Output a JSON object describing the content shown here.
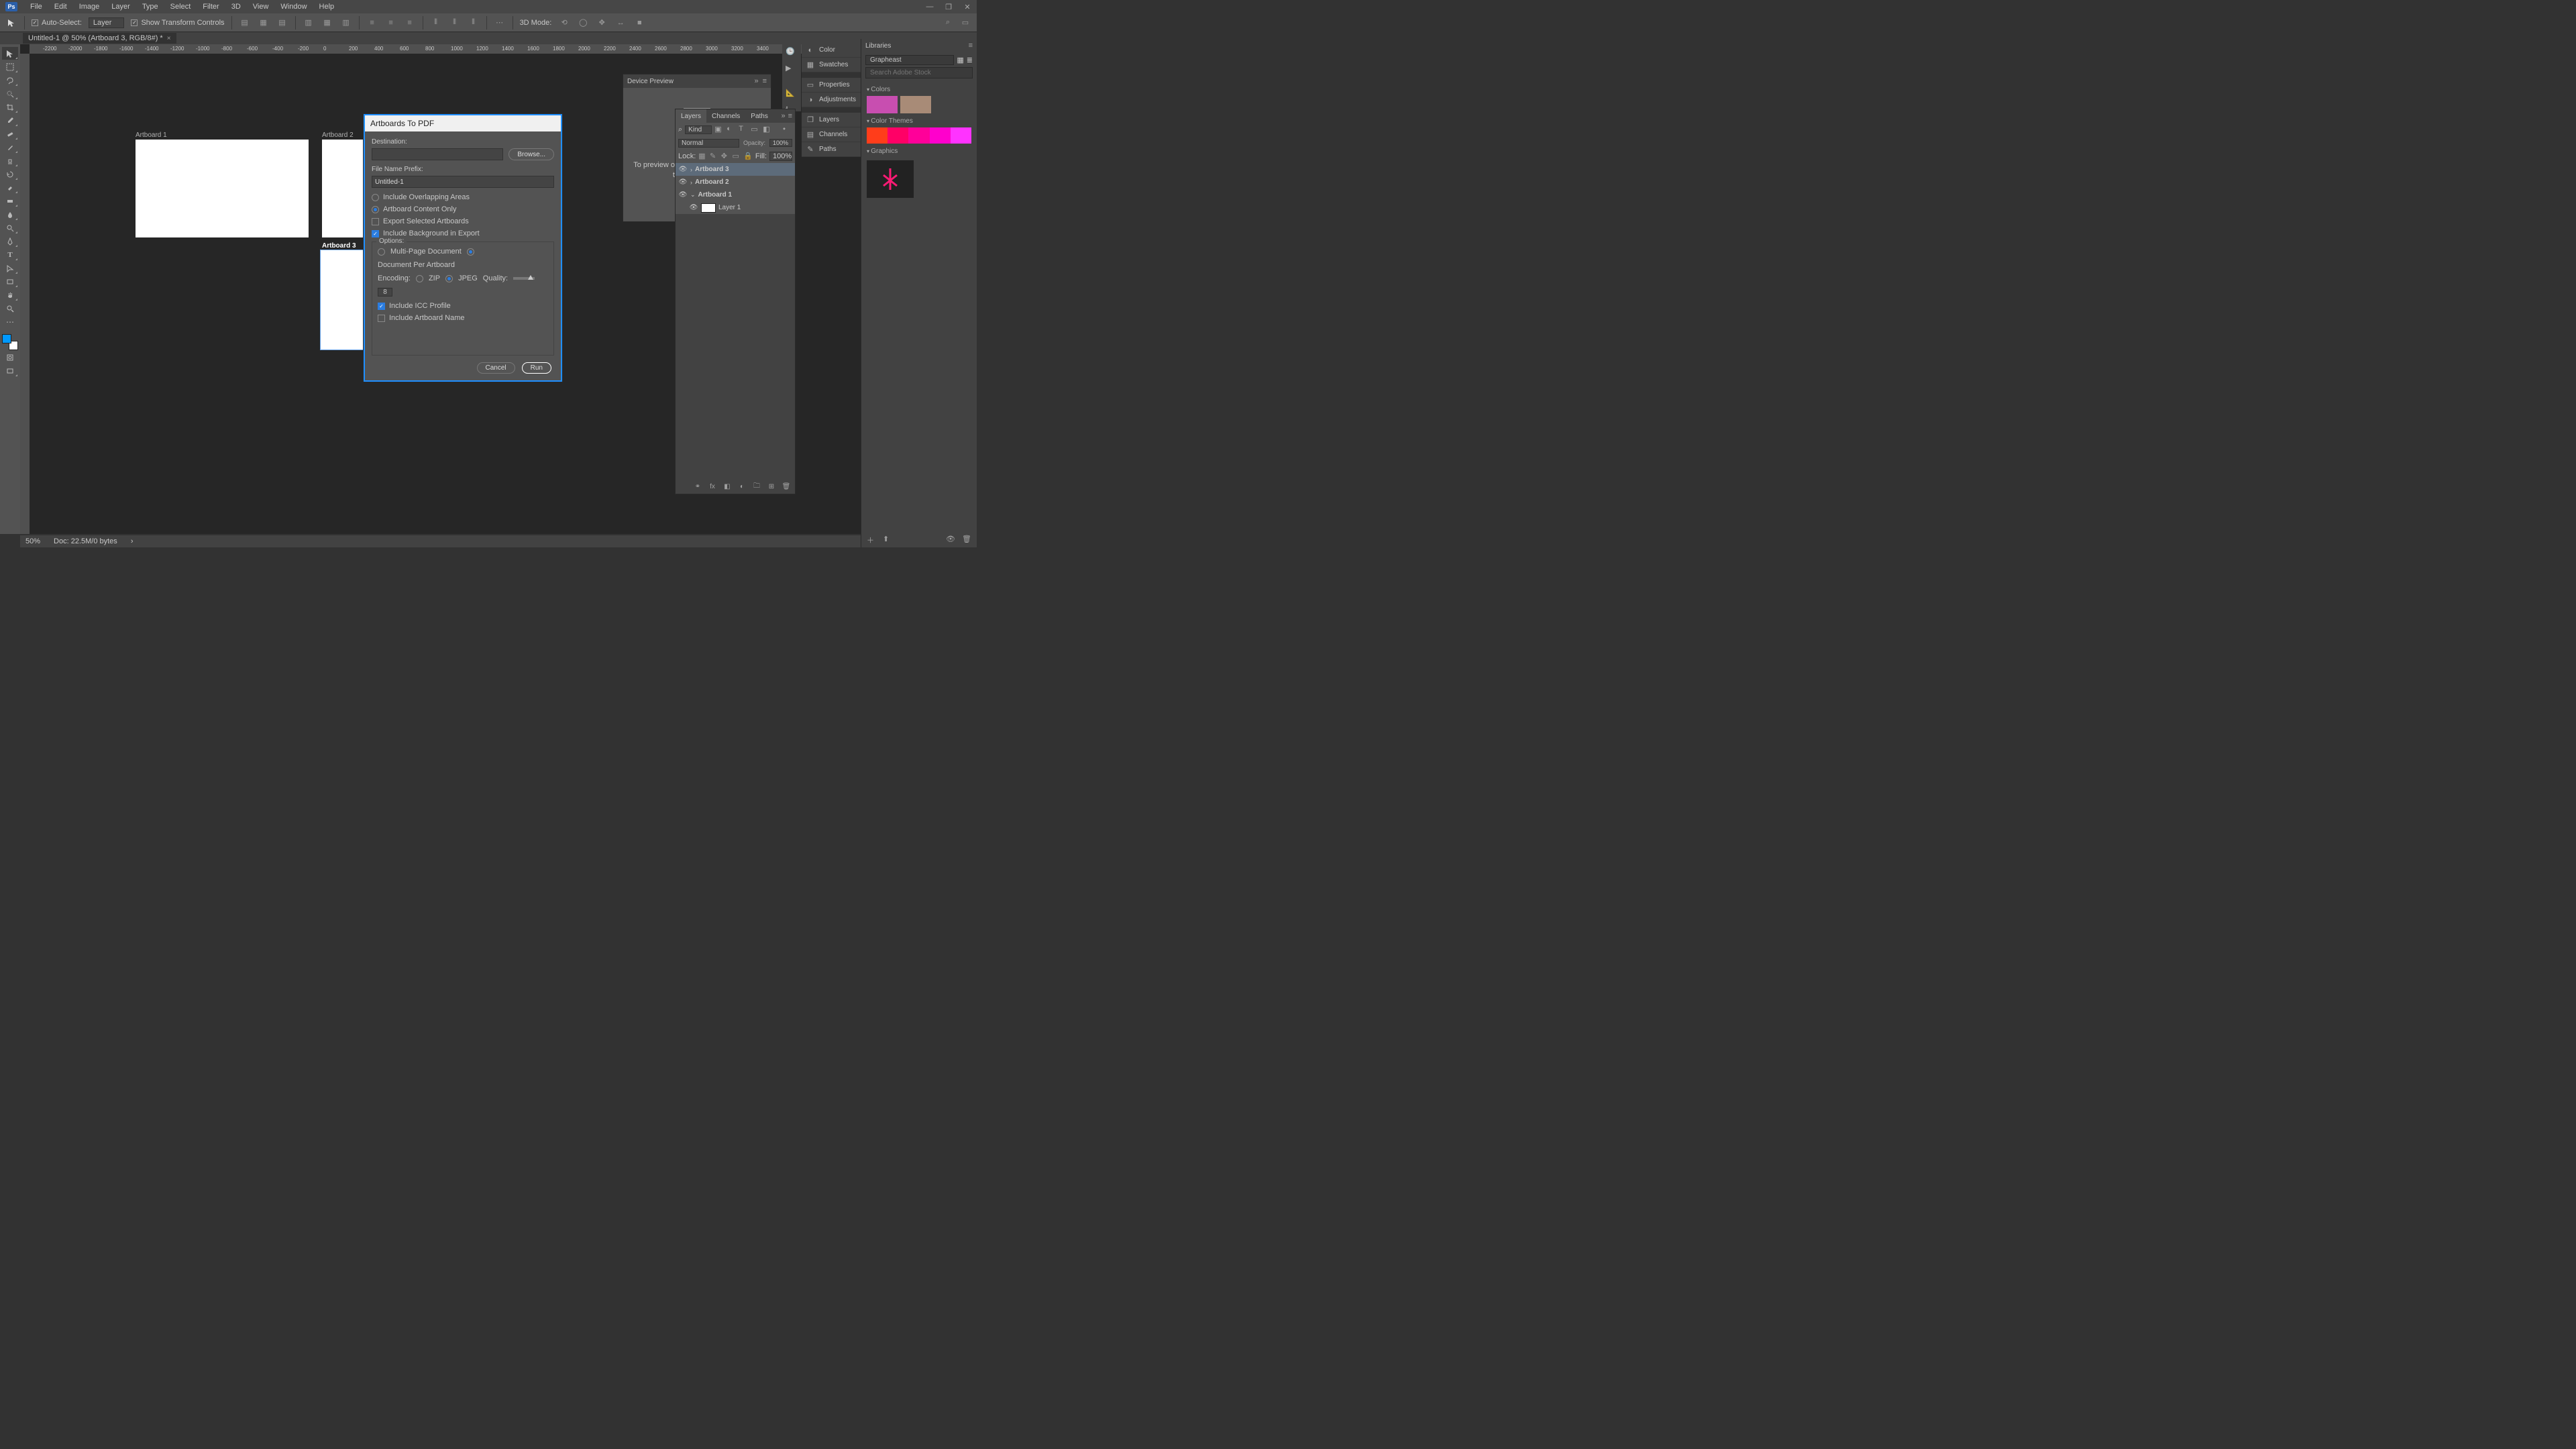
{
  "os": {
    "min": "—",
    "restore": "❐",
    "close": "✕"
  },
  "app": "Ps",
  "menu": [
    "File",
    "Edit",
    "Image",
    "Layer",
    "Type",
    "Select",
    "Filter",
    "3D",
    "View",
    "Window",
    "Help"
  ],
  "options": {
    "auto_select": "Auto-Select:",
    "target": "Layer",
    "show_transform": "Show Transform Controls",
    "mode3d": "3D Mode:"
  },
  "doctab": "Untitled-1 @ 50% (Artboard 3, RGB/8#) *",
  "ruler_marks": [
    -2200,
    -2000,
    -1800,
    -1600,
    -1400,
    -1200,
    -1000,
    -800,
    -600,
    -400,
    -200,
    0,
    200,
    400,
    600,
    800,
    1000,
    1200,
    1400,
    1600,
    1800,
    2000,
    2200,
    2400,
    2600,
    2800,
    3000,
    3200,
    3400
  ],
  "artboards": {
    "a1": "Artboard 1",
    "a2": "Artboard 2",
    "a3": "Artboard 3"
  },
  "device_preview": {
    "title": "Device Preview",
    "text": "To preview on physical devices, launch the mobile app"
  },
  "right_panels": [
    "Color",
    "Swatches",
    "Properties",
    "Adjustments",
    "Layers",
    "Channels",
    "Paths"
  ],
  "layers_panel": {
    "tabs": [
      "Layers",
      "Channels",
      "Paths"
    ],
    "kind": "Kind",
    "blend": "Normal",
    "opacity_label": "Opacity:",
    "opacity_value": "100%",
    "lock_label": "Lock:",
    "fill_label": "Fill:",
    "fill_value": "100%",
    "items": [
      {
        "name": "Artboard 3",
        "bold": true,
        "selected": true
      },
      {
        "name": "Artboard 2",
        "bold": true,
        "selected": false
      },
      {
        "name": "Artboard 1",
        "bold": true,
        "selected": false
      },
      {
        "name": "Layer 1",
        "bold": false,
        "selected": false,
        "thumb": true
      }
    ]
  },
  "libraries": {
    "title": "Libraries",
    "selected": "Grapheast",
    "search_placeholder": "Search Adobe Stock",
    "sections": {
      "colors": "Colors",
      "themes": "Color Themes",
      "graphics": "Graphics"
    },
    "color_swatches": [
      "#c84eb0",
      "#a88b77"
    ],
    "theme": [
      "#ff3d1a",
      "#ff0066",
      "#ff0099",
      "#ff00cc",
      "#ff33ff"
    ],
    "graphic_accent": "#ff1a75"
  },
  "status": {
    "zoom": "50%",
    "doc": "Doc: 22.5M/0 bytes"
  },
  "dialog": {
    "title": "Artboards To PDF",
    "destination_label": "Destination:",
    "browse": "Browse...",
    "prefix_label": "File Name Prefix:",
    "prefix_value": "Untitled-1",
    "overlap": "Include Overlapping Areas",
    "content_only": "Artboard Content Only",
    "export_selected": "Export Selected Artboards",
    "include_bg": "Include Background in Export",
    "options_label": "Options:",
    "multipage": "Multi-Page Document",
    "perartboard": "Document Per Artboard",
    "encoding": "Encoding:",
    "zip": "ZIP",
    "jpeg": "JPEG",
    "quality_label": "Quality:",
    "quality_value": "8",
    "icc": "Include ICC Profile",
    "artboard_name": "Include Artboard Name",
    "cancel": "Cancel",
    "run": "Run"
  }
}
